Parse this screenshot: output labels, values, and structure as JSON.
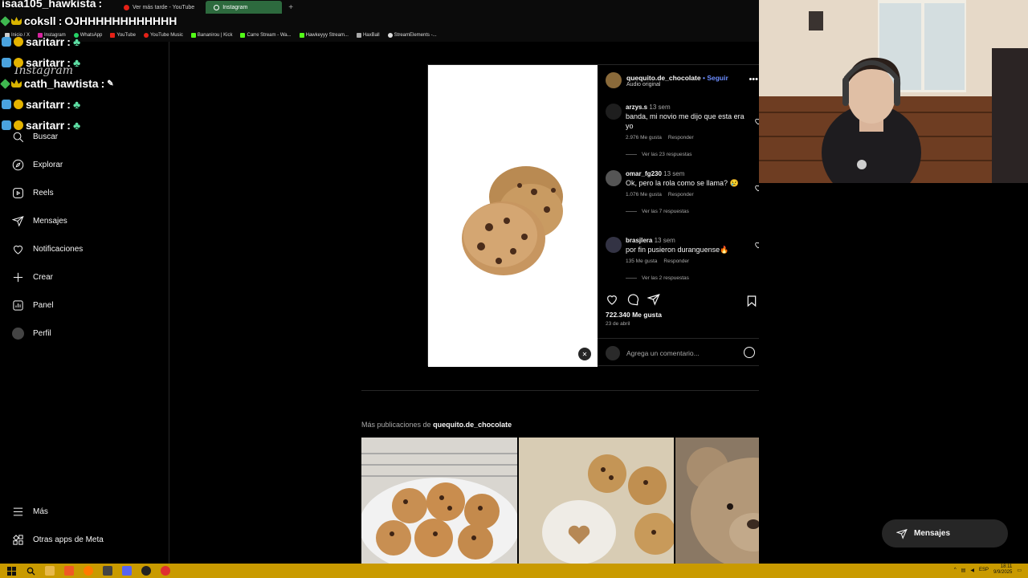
{
  "browser": {
    "tabs": [
      {
        "label": "Ver más tarde - YouTube"
      },
      {
        "label": "Instagram"
      }
    ],
    "bookmarks": [
      "Inicio / X",
      "Instagram",
      "WhatsApp",
      "YouTube",
      "YouTube Music",
      "Bananirou | Kick",
      "Carre Stream - Wa...",
      "Hawkeyyy Stream...",
      "HaxBall",
      "StreamElements -..."
    ]
  },
  "chat": [
    {
      "user": "isaa105_hawkista",
      "message": ""
    },
    {
      "user": "coksll",
      "message": "OJHHHHHHHHHHHH"
    },
    {
      "user": "saritarr",
      "message": ""
    },
    {
      "user": "saritarr",
      "message": ""
    },
    {
      "user": "cath_hawtista",
      "message": ""
    },
    {
      "user": "saritarr",
      "message": ""
    },
    {
      "user": "saritarr",
      "message": ""
    }
  ],
  "sidebar": {
    "logo": "Instagram",
    "items": [
      {
        "label": "Buscar",
        "icon": "search-icon"
      },
      {
        "label": "Explorar",
        "icon": "compass-icon"
      },
      {
        "label": "Reels",
        "icon": "reels-icon"
      },
      {
        "label": "Mensajes",
        "icon": "send-icon"
      },
      {
        "label": "Notificaciones",
        "icon": "heart-icon"
      },
      {
        "label": "Crear",
        "icon": "plus-icon"
      },
      {
        "label": "Panel",
        "icon": "chart-icon"
      },
      {
        "label": "Perfil",
        "icon": "avatar"
      }
    ],
    "bottom": [
      {
        "label": "Más",
        "icon": "menu-icon"
      },
      {
        "label": "Otras apps de Meta",
        "icon": "grid-icon"
      }
    ]
  },
  "post": {
    "author": "quequito.de_chocolate",
    "follow": "Seguir",
    "separator": "•",
    "audio": "Audio original",
    "comments": [
      {
        "user": "arzys.s",
        "time": "13 sem",
        "text": "banda, mi novio me dijo que esta era yo",
        "likes": "2.976 Me gusta",
        "reply": "Responder",
        "replies": "Ver las 23 respuestas"
      },
      {
        "user": "omar_fg230",
        "time": "13 sem",
        "text": "Ok, pero la rola como se llama? 😢",
        "likes": "1.076 Me gusta",
        "reply": "Responder",
        "replies": "Ver las 7 respuestas"
      },
      {
        "user": "brasjlera",
        "time": "13 sem",
        "text": "por fin pusieron duranguense🔥",
        "likes": "135 Me gusta",
        "reply": "Responder",
        "replies": "Ver las 2 respuestas"
      }
    ],
    "likes": "722.340 Me gusta",
    "date": "23 de abril",
    "comment_placeholder": "Agrega un comentario..."
  },
  "more": {
    "prefix": "Más publicaciones de",
    "author": "quequito.de_chocolate"
  },
  "messages_pill": "Mensajes",
  "taskbar": {
    "lang": "ESP",
    "time": "18:11",
    "date": "9/9/2025"
  },
  "colors": {
    "accent": "#6c8dff",
    "taskbar": "#c99a00",
    "active_tab": "#2d6a3e"
  }
}
